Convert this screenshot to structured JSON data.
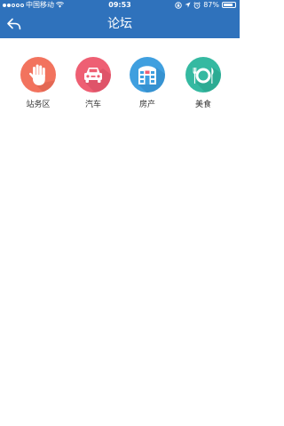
{
  "status_bar": {
    "signal_filled": 2,
    "signal_total": 5,
    "carrier": "中国移动",
    "wifi_icon": "wifi-icon",
    "time": "09:53",
    "icons": [
      "orientation-lock-icon",
      "location-icon",
      "alarm-icon"
    ],
    "battery_percent": "87%",
    "battery_level": 0.87
  },
  "navbar": {
    "back_icon": "back-arrow-icon",
    "title": "论坛",
    "background_color": "#2f72bc"
  },
  "categories": [
    {
      "label": "站务区",
      "icon": "hand-icon",
      "color": "#f2735e"
    },
    {
      "label": "汽车",
      "icon": "car-icon",
      "color": "#ee5f73"
    },
    {
      "label": "房产",
      "icon": "building-icon",
      "color": "#3f9fdf"
    },
    {
      "label": "美食",
      "icon": "dining-icon",
      "color": "#35b9a1"
    }
  ]
}
